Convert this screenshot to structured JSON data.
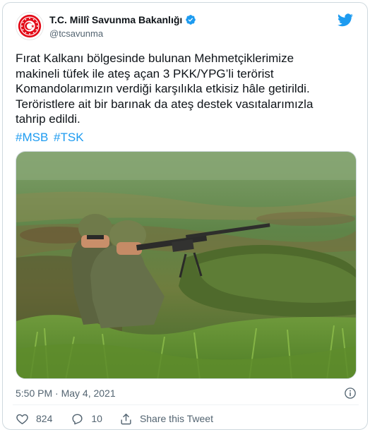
{
  "account": {
    "display_name": "T.C. Millî Savunma Bakanlığı",
    "handle": "@tcsavunma",
    "verified": true
  },
  "tweet": {
    "text": "Fırat Kalkanı bölgesinde bulunan Mehmetçiklerimize\nmakineli tüfek ile ateş açan 3 PKK/YPG’li terörist\nKomandolarımızın verdiği karşılıkla etkisiz hâle getirildi.\nTeröristlere ait bir barınak da ateş destek vasıtalarımızla\ntahrip edildi.",
    "hashtags": [
      "#MSB",
      "#TSK"
    ],
    "timestamp": "5:50 PM · May 4, 2021"
  },
  "actions": {
    "like_count": "824",
    "reply_count": "10",
    "share_label": "Share this Tweet"
  },
  "colors": {
    "accent": "#1d9bf0",
    "secondary_text": "#536471",
    "logo_red": "#e30a17"
  },
  "icons": {
    "brand": "twitter-bird-icon",
    "verified": "verified-badge-icon",
    "info": "info-icon",
    "like": "heart-icon",
    "reply": "reply-bubble-icon",
    "share": "share-upload-icon"
  }
}
